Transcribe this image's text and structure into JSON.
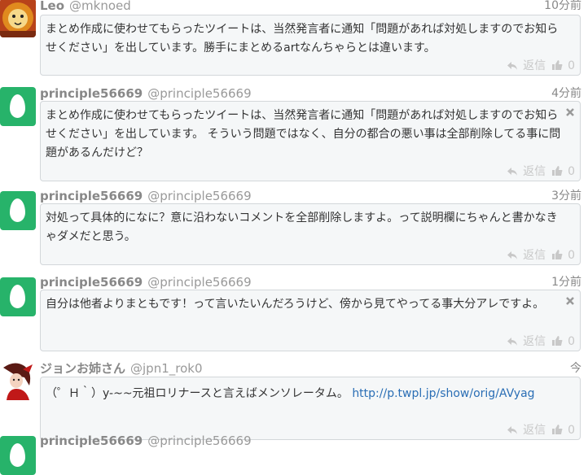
{
  "tweets": [
    {
      "name": "Leo",
      "handle": "@mknoed",
      "time": "10分前",
      "text": "まとめ作成に使わせてもらったツイートは、当然発言者に通知「問題があれば対処しますのでお知らせください」を出しています。勝手にまとめるartなんちゃらとは違います。",
      "reply_label": "返信",
      "likes": "0",
      "avatar_icon": "lion-avatar-icon"
    },
    {
      "name": "principle56669",
      "handle": "@principle56669",
      "time": "4分前",
      "text": "まとめ作成に使わせてもらったツイートは、当然発言者に通知「問題があれば対処しますのでお知らせください」を出しています。 そういう問題ではなく、自分の都合の悪い事は全部削除してる事に問題があるんだけど？",
      "reply_label": "返信",
      "likes": "0",
      "avatar_icon": "egg-avatar-icon"
    },
    {
      "name": "principle56669",
      "handle": "@principle56669",
      "time": "3分前",
      "text": "対処って具体的になに？意に沿わないコメントを全部削除しますよ。って説明欄にちゃんと書かなきゃダメだと思う。",
      "reply_label": "返信",
      "likes": "0",
      "avatar_icon": "egg-avatar-icon"
    },
    {
      "name": "principle56669",
      "handle": "@principle56669",
      "time": "1分前",
      "text": "自分は他者よりまともです！って言いたいんだろうけど、傍から見てやってる事大分アレですよ。",
      "reply_label": "返信",
      "likes": "0",
      "avatar_icon": "egg-avatar-icon"
    },
    {
      "name": "ジョンお姉さん",
      "handle": "@jpn1_rok0",
      "time": "今",
      "text": "（゜Ｈ｀）y-~~元祖ロリナースと言えばメンソレータム。",
      "link": "http://p.twpl.jp/show/orig/AVyag",
      "reply_label": "返信",
      "likes": "0",
      "avatar_icon": "girl-avatar-icon"
    },
    {
      "name": "principle56669",
      "handle": "@principle56669",
      "avatar_icon": "egg-avatar-icon"
    }
  ],
  "colors": {
    "egg_green": "#27b36a",
    "link": "#2a6eb5",
    "bubble_bg": "#f5f7f8",
    "muted": "#c8c8c8"
  }
}
